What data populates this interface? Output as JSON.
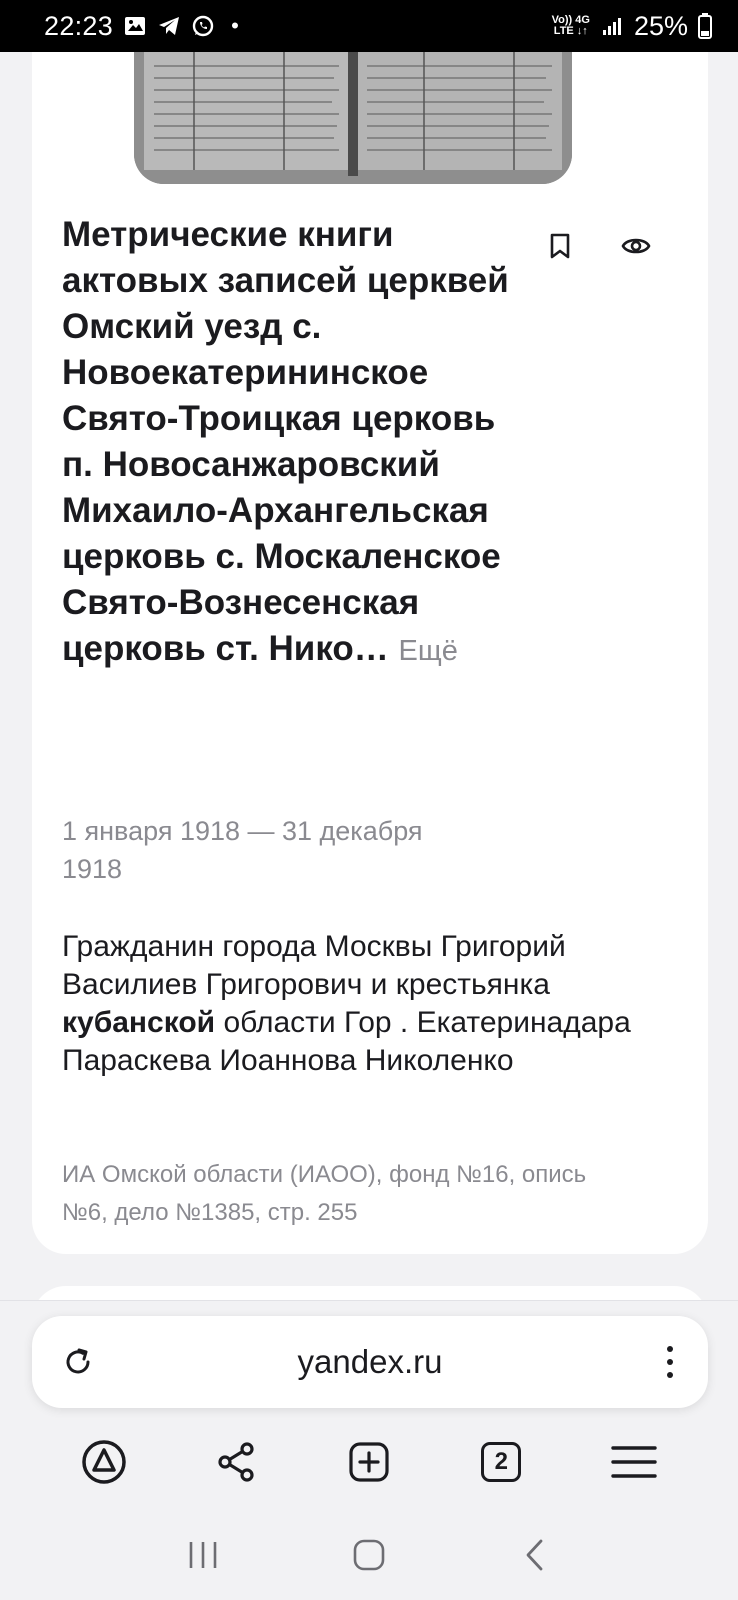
{
  "status_bar": {
    "time": "22:23",
    "dot": "•",
    "net_top": "Vo)) 4G",
    "net_bottom": "LTE ↓↑",
    "battery": "25%",
    "icons": [
      "gallery-icon",
      "telegram-icon",
      "whatsapp-icon",
      "signal-icon",
      "battery-icon"
    ]
  },
  "card": {
    "image_name": "metric-book-scan",
    "title": "Метрические книги актовых записей церквей Омский уезд с. Новоекатерининское Свято-Троицкая церковь п. Новосанжаровский Михаило-Архангельская церковь с. Москаленское Свято-Вознесенская церковь ст. Нико…",
    "more_label": "Ещё",
    "date_range": "1 января 1918 — 31 декабря 1918",
    "description_before": "Гражданин города Москвы Григорий Василиев Григорович и крестьянка ",
    "description_bold": "кубанской",
    "description_after": " области Гор . Екатеринадара Параскева Иоаннова Николенко",
    "source": "ИА Омской области (ИАОО), фонд №16, опись №6, дело №1385, стр. 255"
  },
  "browser": {
    "url": "yandex.ru",
    "tabs_count": "2",
    "toolbar_icons": [
      "alice-icon",
      "share-icon",
      "new-tab-icon",
      "tabs-icon",
      "menu-icon"
    ]
  },
  "nav": {
    "icons": [
      "recent-apps-icon",
      "home-icon",
      "back-icon"
    ]
  },
  "colors": {
    "background": "#f2f2f4",
    "card": "#ffffff",
    "secondary_text": "#8a8a90",
    "primary_text": "#1b1b1f"
  }
}
